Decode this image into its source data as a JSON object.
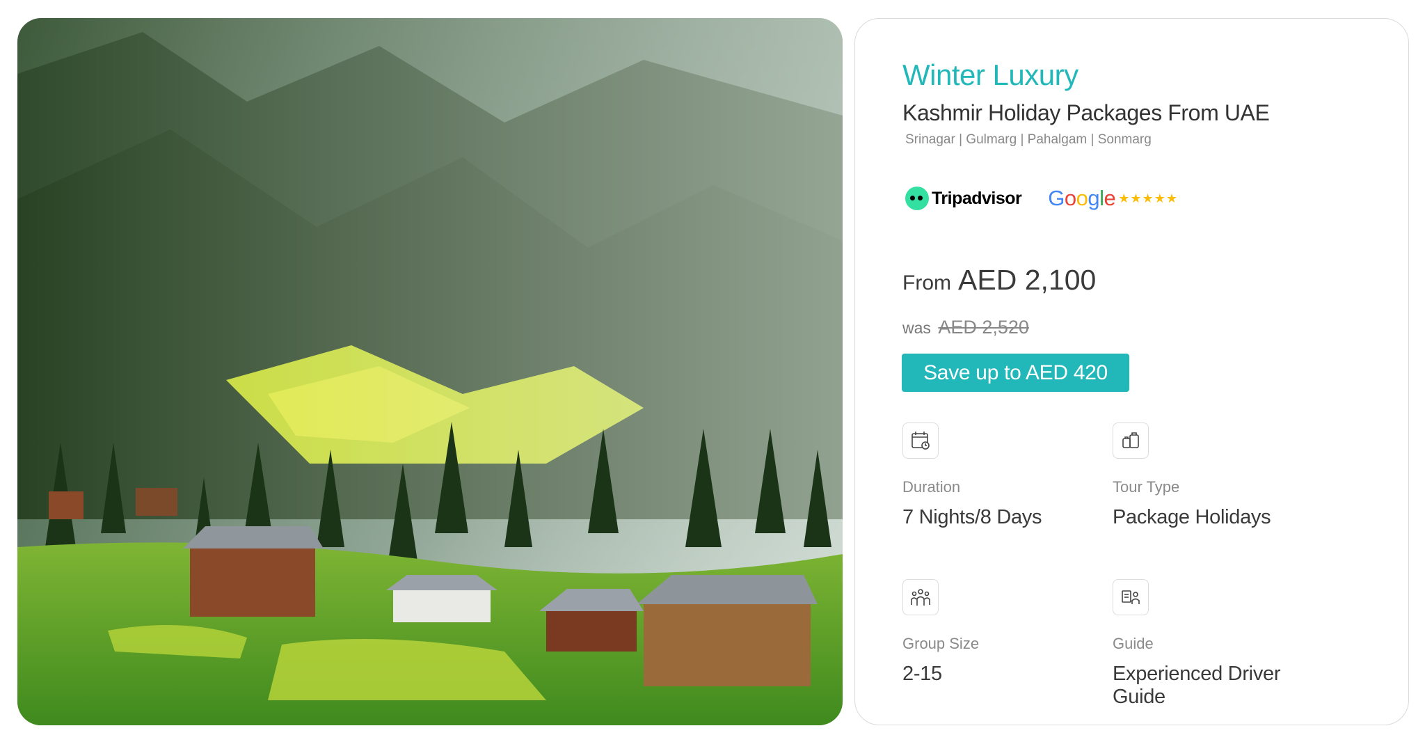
{
  "hero_image": {
    "alt": "Kashmir valley"
  },
  "package": {
    "category": "Winter Luxury",
    "title": "Kashmir Holiday Packages From UAE",
    "destinations": "Srinagar | Gulmarg | Pahalgam | Sonmarg"
  },
  "ratings": {
    "tripadvisor_label": "Tripadvisor",
    "google_label": "Google",
    "google_stars": "★★★★★",
    "google_colors": [
      "#4285F4",
      "#EA4335",
      "#FBBC05",
      "#4285F4",
      "#34A853",
      "#EA4335"
    ]
  },
  "pricing": {
    "from_label": "From",
    "price": "AED 2,100",
    "was_label": "was",
    "old_price": "AED 2,520",
    "save_button": "Save up to AED 420"
  },
  "features": [
    {
      "icon": "calendar-icon",
      "label": "Duration",
      "value": "7 Nights/8 Days"
    },
    {
      "icon": "luggage-icon",
      "label": "Tour Type",
      "value": "Package Holidays"
    },
    {
      "icon": "group-icon",
      "label": "Group Size",
      "value": "2-15"
    },
    {
      "icon": "guide-icon",
      "label": "Guide",
      "value": "Experienced Driver Guide"
    }
  ],
  "colors": {
    "accent": "#22b7b8",
    "text": "#3a3a3a",
    "muted": "#888888",
    "star": "#fbbc05"
  }
}
